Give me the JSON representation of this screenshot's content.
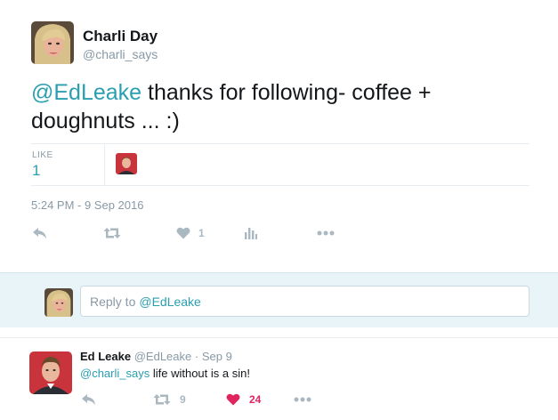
{
  "tweet": {
    "author_name": "Charli Day",
    "author_handle": "@charli_says",
    "text_mention": "@EdLeake",
    "text_rest": " thanks for following- coffee + doughnuts ... :)",
    "likes_label": "LIKE",
    "likes_count": "1",
    "timestamp": "5:24 PM - 9 Sep 2016",
    "actions": {
      "reply_icon": "reply-icon",
      "retweet_icon": "retweet-icon",
      "like_icon": "heart-icon",
      "like_count": "1",
      "analytics_icon": "analytics-icon",
      "more_icon": "more-icon"
    }
  },
  "reply_box": {
    "prefix": "Reply to",
    "mention": "@EdLeake"
  },
  "reply_tweet": {
    "author_name": "Ed Leake",
    "author_handle": "@EdLeake",
    "separator": "·",
    "date": "Sep 9",
    "text_mention": "@charli_says",
    "text_rest": " life without is a sin!",
    "retweet_count": "9",
    "like_count": "24"
  },
  "colors": {
    "accent": "#2a9fb0",
    "muted": "#8899a6",
    "icon": "#aab8c2",
    "like_active": "#e0245e",
    "reply_bg": "#e8f4f7"
  }
}
